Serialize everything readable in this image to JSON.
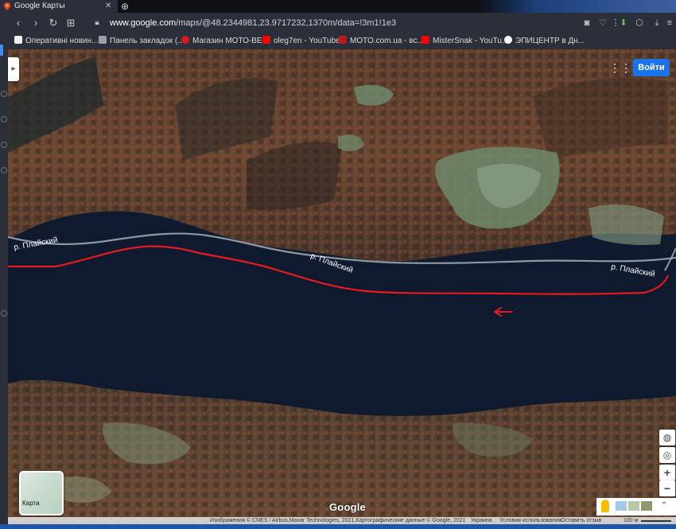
{
  "browser": {
    "tab_title": "Google Карты",
    "url_host": "www.google.com",
    "url_path": "/maps/@48.2344981,23.9717232,1370m/data=!3m1!1e3",
    "bookmarks": [
      {
        "label": "Оперативні новин...",
        "icon_color": "#f0f0f0"
      },
      {
        "label": "Панель закладок (...",
        "icon_color": "#9aa0a6"
      },
      {
        "label": "Магазин МОТО-ВЕ...",
        "icon_color": "#d21c1c"
      },
      {
        "label": "oleg7en - YouTube",
        "icon_color": "#ff0000"
      },
      {
        "label": "MOTO.com.ua - вс...",
        "icon_color": "#c01818"
      },
      {
        "label": "MisterSnak - YouTu...",
        "icon_color": "#ff0000"
      },
      {
        "label": "ЭПИЦЕНТР в Дн...",
        "icon_color": "#ffffff"
      }
    ]
  },
  "map": {
    "signin_label": "Войти",
    "minimap_label": "Карта",
    "logo_text": "Google",
    "river_labels": [
      "р. Плайский",
      "р. Плайский",
      "р. Плайский"
    ],
    "footer": {
      "attribution": "Изображения © CNES / Airbus,Maxar Technologies, 2021,Картографические данные © Google, 2021",
      "country": "Украина",
      "terms": "Условия использования",
      "feedback": "Оставить отзыв",
      "scale": "100 м"
    },
    "colors": {
      "route": "#e8191f",
      "road": "#9aa7b0",
      "signin": "#1a73e8"
    }
  }
}
